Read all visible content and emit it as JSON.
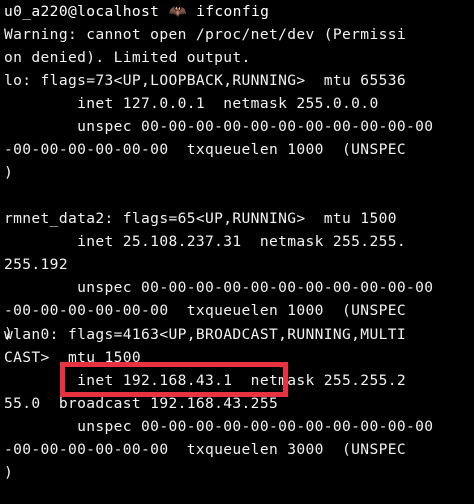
{
  "prompt": {
    "user_host": "u0_a220@localhost",
    "icon": "mascot-glyph",
    "command": "ifconfig"
  },
  "output": {
    "lines": [
      "Warning: cannot open /proc/net/dev (Permissi",
      "on denied). Limited output.",
      "lo: flags=73<UP,LOOPBACK,RUNNING>  mtu 65536",
      "        inet 127.0.0.1  netmask 255.0.0.0",
      "        unspec 00-00-00-00-00-00-00-00-00-00-00",
      "-00-00-00-00-00-00  txqueuelen 1000  (UNSPEC",
      ")",
      "",
      "rmnet_data2: flags=65<UP,RUNNING>  mtu 1500",
      "        inet 25.108.237.31  netmask 255.255.",
      "255.192",
      "        unspec 00-00-00-00-00-00-00-00-00-00-00",
      "-00-00-00-00-00-00  txqueuelen 1000  (UNSPEC",
      ")",
      "",
      "wlan0: flags=4163<UP,BROADCAST,RUNNING,MULTI",
      "CAST>  mtu 1500",
      "        inet 192.168.43.1  netmask 255.255.2",
      "55.0  broadcast 192.168.43.255",
      "        unspec 00-00-00-00-00-00-00-00-00-00-00",
      "-00-00-00-00-00-00  txqueuelen 3000  (UNSPEC",
      ")"
    ]
  },
  "colors": {
    "background": "#000000",
    "text": "#f2f2f2",
    "highlight": "#e8323f"
  }
}
